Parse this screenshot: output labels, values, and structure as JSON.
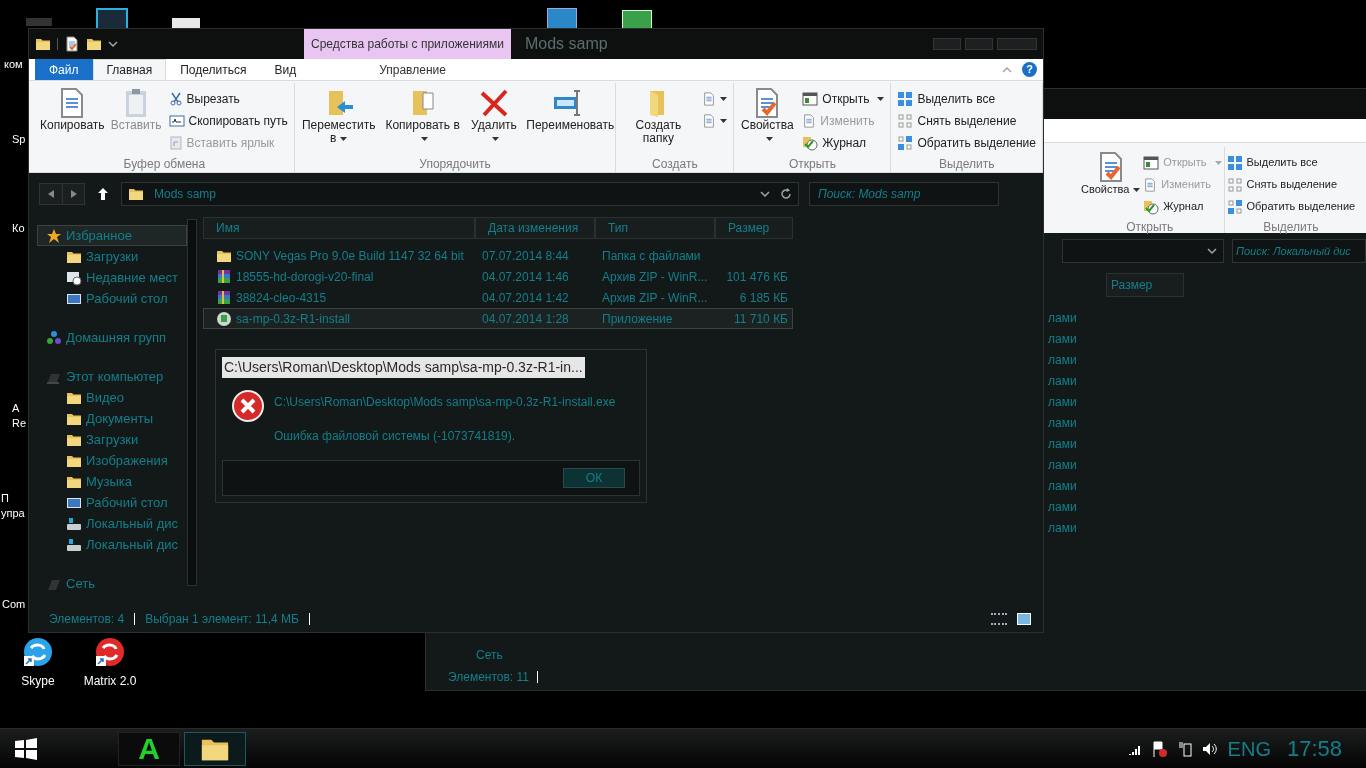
{
  "desktop": {
    "side_labels": [
      {
        "lines": [
          "ком"
        ]
      },
      {
        "lines": [
          "Sp"
        ]
      },
      {
        "lines": [
          "Ко"
        ]
      },
      {
        "lines": [
          "A",
          "Re"
        ]
      },
      {
        "lines": [
          "П",
          "упра"
        ]
      },
      {
        "lines": [
          "Com"
        ]
      }
    ],
    "shortcuts": [
      {
        "label": "Skype"
      },
      {
        "label": "Matrix 2.0"
      }
    ]
  },
  "back_window": {
    "ribbon": {
      "groups": [
        {
          "label": "Открыть",
          "items": [
            {
              "label": "Свойства",
              "kind": "large",
              "dropdown": true,
              "disabled": false
            },
            {
              "label": "Открыть",
              "kind": "small",
              "dropdown": true,
              "disabled": true
            },
            {
              "label": "Изменить",
              "kind": "small",
              "dropdown": false,
              "disabled": true
            },
            {
              "label": "Журнал",
              "kind": "small",
              "dropdown": false,
              "disabled": false
            }
          ]
        },
        {
          "label": "Выделить",
          "items": [
            {
              "label": "Выделить все",
              "kind": "small",
              "dropdown": false,
              "disabled": false
            },
            {
              "label": "Снять выделение",
              "kind": "small",
              "dropdown": false,
              "disabled": false
            },
            {
              "label": "Обратить выделение",
              "kind": "small",
              "dropdown": false,
              "disabled": false
            }
          ]
        }
      ]
    },
    "search": {
      "placeholder": "Поиск: Локальный дис"
    },
    "columns": [
      "Размер"
    ],
    "rows": [
      "лами",
      "лами",
      "лами",
      "лами",
      "лами",
      "лами",
      "лами",
      "лами",
      "лами",
      "лами",
      "лами"
    ],
    "nav_items": [
      "Сеть"
    ],
    "status": "Элементов: 11"
  },
  "window": {
    "title": "Mods samp",
    "context_tab": "Средства работы с приложениями",
    "tabs": [
      {
        "label": "Файл",
        "kind": "file",
        "selected": false
      },
      {
        "label": "Главная",
        "kind": "normal",
        "selected": true
      },
      {
        "label": "Поделиться",
        "kind": "normal",
        "selected": false
      },
      {
        "label": "Вид",
        "kind": "normal",
        "selected": false
      },
      {
        "label": "Управление",
        "kind": "context",
        "selected": false
      }
    ],
    "ribbon": {
      "groups": [
        {
          "label": "Буфер обмена",
          "items": [
            {
              "label": "Копировать",
              "kind": "large",
              "dropdown": false,
              "disabled": false
            },
            {
              "label": "Вставить",
              "kind": "large",
              "dropdown": false,
              "disabled": true
            },
            {
              "label": "Вырезать",
              "kind": "small",
              "dropdown": false,
              "disabled": false
            },
            {
              "label": "Скопировать путь",
              "kind": "small",
              "dropdown": false,
              "disabled": false
            },
            {
              "label": "Вставить ярлык",
              "kind": "small",
              "dropdown": false,
              "disabled": true
            }
          ]
        },
        {
          "label": "Упорядочить",
          "items": [
            {
              "label": "Переместить в",
              "kind": "large",
              "dropdown": true,
              "disabled": false
            },
            {
              "label": "Копировать в",
              "kind": "large",
              "dropdown": true,
              "disabled": false
            },
            {
              "label": "Удалить",
              "kind": "large",
              "dropdown": true,
              "disabled": false
            },
            {
              "label": "Переименовать",
              "kind": "large",
              "dropdown": false,
              "disabled": false
            }
          ]
        },
        {
          "label": "Создать",
          "items": [
            {
              "label": "Создать папку",
              "kind": "large",
              "dropdown": false,
              "disabled": false
            },
            {
              "kind": "icon",
              "dropdown": true,
              "disabled": false
            },
            {
              "kind": "icon",
              "dropdown": true,
              "disabled": false
            }
          ]
        },
        {
          "label": "Открыть",
          "items": [
            {
              "label": "Свойства",
              "kind": "large",
              "dropdown": true,
              "disabled": false
            },
            {
              "label": "Открыть",
              "kind": "small",
              "dropdown": true,
              "disabled": false
            },
            {
              "label": "Изменить",
              "kind": "small",
              "dropdown": false,
              "disabled": true
            },
            {
              "label": "Журнал",
              "kind": "small",
              "dropdown": false,
              "disabled": false
            }
          ]
        },
        {
          "label": "Выделить",
          "items": [
            {
              "label": "Выделить все",
              "kind": "small",
              "dropdown": false,
              "disabled": false
            },
            {
              "label": "Снять выделение",
              "kind": "small",
              "dropdown": false,
              "disabled": false
            },
            {
              "label": "Обратить выделение",
              "kind": "small",
              "dropdown": false,
              "disabled": false
            }
          ]
        }
      ]
    },
    "help_button": "?",
    "address": "Mods samp",
    "search": {
      "placeholder": "Поиск: Mods samp"
    },
    "nav": [
      {
        "label": "Избранное",
        "kind": "favorites",
        "selected": true,
        "children": [
          {
            "label": "Загрузки",
            "kind": "downloads",
            "selected": false
          },
          {
            "label": "Недавние мест",
            "kind": "recent",
            "selected": false
          },
          {
            "label": "Рабочий стол",
            "kind": "desktop",
            "selected": false
          }
        ]
      },
      {
        "label": "Домашняя групп",
        "kind": "homegroup",
        "selected": false
      },
      {
        "label": "Этот компьютер",
        "kind": "computer",
        "selected": false,
        "children": [
          {
            "label": "Видео",
            "kind": "video",
            "selected": false
          },
          {
            "label": "Документы",
            "kind": "documents",
            "selected": false
          },
          {
            "label": "Загрузки",
            "kind": "downloads",
            "selected": false
          },
          {
            "label": "Изображения",
            "kind": "pictures",
            "selected": false
          },
          {
            "label": "Музыка",
            "kind": "music",
            "selected": false
          },
          {
            "label": "Рабочий стол",
            "kind": "desktop",
            "selected": false
          },
          {
            "label": "Локальный дис",
            "kind": "drive",
            "selected": false
          },
          {
            "label": "Локальный дис",
            "kind": "drive",
            "selected": false
          }
        ]
      },
      {
        "label": "Сеть",
        "kind": "network",
        "selected": false
      }
    ],
    "columns": [
      "Имя",
      "Дата изменения",
      "Тип",
      "Размер"
    ],
    "rows": [
      {
        "name": "SONY Vegas Pro 9.0e Build 1147 32 64 bit",
        "date": "07.07.2014 8:44",
        "type": "Папка с файлами",
        "size": "",
        "kind": "folder",
        "selected": false
      },
      {
        "name": "18555-hd-dorogi-v20-final",
        "date": "04.07.2014 1:46",
        "type": "Архив ZIP - WinR...",
        "size": "101 476 КБ",
        "kind": "archive",
        "selected": false
      },
      {
        "name": "38824-cleo-4315",
        "date": "04.07.2014 1:42",
        "type": "Архив ZIP - WinR...",
        "size": "6 185 КБ",
        "kind": "archive",
        "selected": false
      },
      {
        "name": "sa-mp-0.3z-R1-install",
        "date": "04.07.2014 1:28",
        "type": "Приложение",
        "size": "11 710 КБ",
        "kind": "app",
        "selected": true
      }
    ],
    "status": [
      "Элементов: 4",
      "Выбран 1 элемент: 11,4 МБ"
    ]
  },
  "dialog": {
    "title": "C:\\Users\\Roman\\Desktop\\Mods samp\\sa-mp-0.3z-R1-in...",
    "path": "C:\\Users\\Roman\\Desktop\\Mods samp\\sa-mp-0.3z-R1-install.exe",
    "message": "Ошибка файловой системы (-1073741819).",
    "button": "ОК"
  },
  "taskbar": {
    "apps": [
      {
        "glyph": "A",
        "kind": "letter",
        "selected": false
      },
      {
        "kind": "explorer",
        "selected": true
      }
    ],
    "language": "ENG",
    "time": "17:58"
  }
}
